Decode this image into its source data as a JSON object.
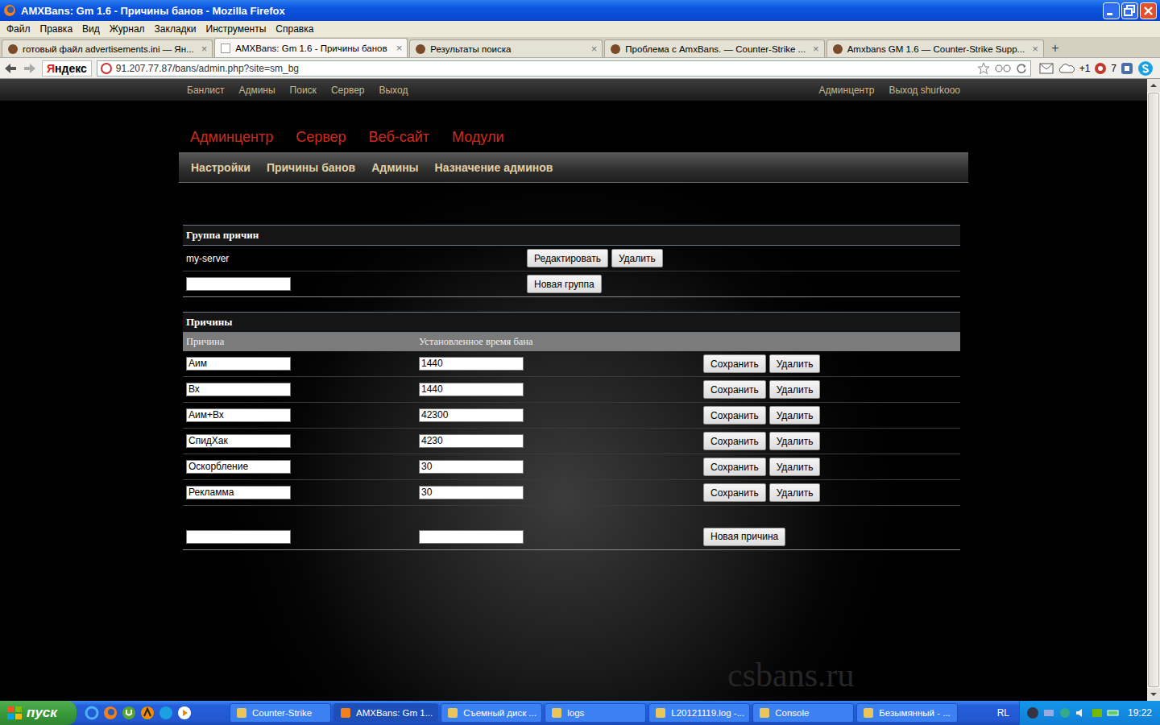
{
  "window": {
    "title": "AMXBans: Gm 1.6 - Причины банов - Mozilla Firefox"
  },
  "menu": [
    "Файл",
    "Правка",
    "Вид",
    "Журнал",
    "Закладки",
    "Инструменты",
    "Справка"
  ],
  "tabs": [
    {
      "label": "готовый файл advertisements.ini — Ян...",
      "selected": false
    },
    {
      "label": "AMXBans: Gm 1.6 - Причины банов",
      "selected": true
    },
    {
      "label": "Результаты поиска",
      "selected": false
    },
    {
      "label": "Проблема с AmxBans. — Counter-Strike ...",
      "selected": false
    },
    {
      "label": "Amxbans GM 1.6 — Counter-Strike Supp...",
      "selected": false
    }
  ],
  "new_tab": "+",
  "close_glyph": "×",
  "address_bar": {
    "logo": "Яндекс",
    "url": "91.207.77.87/bans/admin.php?site=sm_bg"
  },
  "toolbar_badges": [
    "+1",
    "7"
  ],
  "site_nav": {
    "left": [
      "Банлист",
      "Админы",
      "Поиск",
      "Сервер",
      "Выход"
    ],
    "right": [
      "Админцентр",
      "Выход shurkooo"
    ]
  },
  "main_menu": [
    "Админцентр",
    "Сервер",
    "Веб-сайт",
    "Модули"
  ],
  "sub_menu": [
    "Настройки",
    "Причины банов",
    "Админы",
    "Назначение админов"
  ],
  "groups": {
    "title": "Группа причин",
    "rows": [
      {
        "name": "my-server",
        "buttons": [
          "Редактировать",
          "Удалить"
        ]
      }
    ],
    "new": {
      "value": "",
      "button": "Новая группа"
    }
  },
  "reasons": {
    "title": "Причины",
    "columns": [
      "Причина",
      "Установленное время бана"
    ],
    "rows": [
      {
        "reason": "Аим",
        "time": "1440"
      },
      {
        "reason": "Вх",
        "time": "1440"
      },
      {
        "reason": "Аим+Вх",
        "time": "42300"
      },
      {
        "reason": "СпидХак",
        "time": "4230"
      },
      {
        "reason": "Оскорбление",
        "time": "30"
      },
      {
        "reason": "Рекламма",
        "time": "30"
      }
    ],
    "row_buttons": [
      "Сохранить",
      "Удалить"
    ],
    "new": {
      "reason": "",
      "time": "",
      "button": "Новая причина"
    }
  },
  "watermark": "csbans.ru",
  "taskbar": {
    "start": "пуск",
    "tasks": [
      {
        "label": "Counter-Strike",
        "selected": false
      },
      {
        "label": "AMXBans: Gm 1...",
        "selected": true
      },
      {
        "label": "Съемный диск ...",
        "selected": false
      },
      {
        "label": "logs",
        "selected": false
      },
      {
        "label": "L20121119.log -...",
        "selected": false
      },
      {
        "label": "Console",
        "selected": false
      },
      {
        "label": "Безымянный - ...",
        "selected": false
      }
    ],
    "lang": "RL",
    "clock": "19:22"
  }
}
